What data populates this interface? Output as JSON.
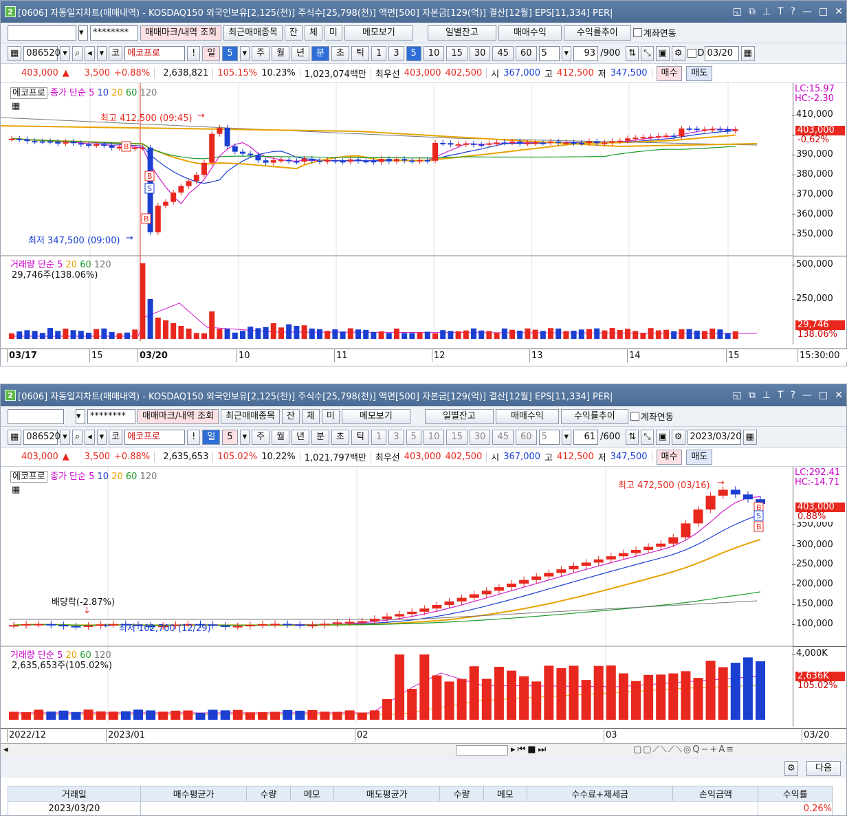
{
  "title": "[0606] 자동일지차트(매매내역) - KOSDAQ150 외국인보유[2,125(천)] 주식수[25,798(천)] 액면[500] 자본금[129(억)] 결산[12월] EPS[11,334] PER|",
  "window_num": "2",
  "toolbar": {
    "password": "********",
    "mark_btn": "매매마크/내역 조회",
    "recent_btn": "최근매매종목",
    "jan": "잔",
    "che": "체",
    "mi": "미",
    "memo_btn": "메모보기",
    "daily_btn": "일별잔고",
    "profit_btn": "매매수익",
    "rate_btn": "수익률추이",
    "account_link": "계좌연동"
  },
  "row2": {
    "code": "086520",
    "market": "코",
    "name": "에코프로",
    "excl": "!",
    "periods": [
      "일",
      "5",
      "주",
      "월",
      "년",
      "분",
      "초",
      "틱"
    ],
    "intervals": [
      "1",
      "3",
      "5",
      "10",
      "15",
      "30",
      "45",
      "60"
    ],
    "count": "5",
    "d": "D"
  },
  "w1": {
    "selected_period": "분",
    "range_value": "93",
    "range_max": "/900",
    "date": "03/20"
  },
  "w2": {
    "selected_period": "일",
    "range_value": "61",
    "range_max": "/600",
    "date": "2023/03/20"
  },
  "quote1": {
    "price": "403,000",
    "arrow": "▲",
    "change": "3,500",
    "pct": "+0.88%",
    "volume": "2,638,821",
    "vol_ratio": "105.15%",
    "turnover": "10.23%",
    "amount": "1,023,074백만",
    "best_label": "최우선",
    "ask": "403,000",
    "bid": "402,500",
    "open_label": "시",
    "open": "367,000",
    "high_label": "고",
    "high": "412,500",
    "low_label": "저",
    "low": "347,500",
    "buy": "매수",
    "sell": "매도"
  },
  "quote2": {
    "price": "403,000",
    "arrow": "▲",
    "change": "3,500",
    "pct": "+0.88%",
    "volume": "2,635,653",
    "vol_ratio": "105.02%",
    "turnover": "10.22%",
    "amount": "1,021,797백만",
    "best_label": "최우선",
    "ask": "403,000",
    "bid": "402,500",
    "open_label": "시",
    "open": "367,000",
    "high_label": "고",
    "high": "412,500",
    "low_label": "저",
    "low": "347,500",
    "buy": "매수",
    "sell": "매도"
  },
  "legend": {
    "name": "에코프로",
    "price": "종가 단순",
    "ma5": "5",
    "ma10": "10",
    "ma20": "20",
    "ma60": "60",
    "ma120": "120",
    "vol": "거래량",
    "vol_simple": "단순"
  },
  "c1": {
    "lc": "LC:15.97",
    "hc": "HC:-2.30",
    "cur": "403,000",
    "cur_pct": "-0.62%",
    "high_ann": "최고 412,500 (09:45)",
    "low_ann": "최저 347,500 (09:00)",
    "vol_label": "29,746주(138.06%)",
    "vol_tag": "29,746",
    "vol_tag_pct": "138.06%",
    "yticks": [
      "410,000",
      "400,000",
      "390,000",
      "380,000",
      "370,000",
      "360,000",
      "350,000"
    ],
    "vticks": [
      "500,000",
      "250,000"
    ],
    "dates": [
      "03/17",
      "15",
      "03/20",
      "10",
      "11",
      "12",
      "13",
      "14",
      "15"
    ],
    "time": "15:30:00"
  },
  "c2": {
    "lc": "LC:292.41",
    "hc": "HC:-14.71",
    "cur": "403,000",
    "cur_pct": "0.88%",
    "high_ann": "최고 472,500 (03/16)",
    "low_ann": "최저 102,700 (12/29)",
    "div_ann": "배당락(-2.87%)",
    "vol_label": "2,635,653주(105.02%)",
    "vol_tag": "2,636K",
    "vol_tag_pct": "105.02%",
    "yticks": [
      "350,000",
      "300,000",
      "250,000",
      "200,000",
      "150,000",
      "100,000"
    ],
    "vticks": [
      "4,000K"
    ],
    "dates": [
      "2022/12",
      "2023/01",
      "02",
      "03"
    ],
    "end": "03/20"
  },
  "bottom": {
    "next": "다음",
    "headers": [
      "거래일",
      "매수평균가",
      "수량",
      "메모",
      "매도평균가",
      "수량",
      "메모",
      "수수료+제세금",
      "손익금액",
      "수익률"
    ],
    "row": [
      "2023/03/20",
      "",
      "",
      "",
      "",
      "",
      "",
      "",
      "",
      "0.26%"
    ]
  },
  "chart_data": [
    {
      "type": "candlestick",
      "ylim": [
        340000,
        420000
      ],
      "high": 412500,
      "low": 347500,
      "current": 403000
    },
    {
      "type": "candlestick",
      "ylim": [
        80000,
        480000
      ],
      "high": 472500,
      "low": 102700,
      "current": 403000
    }
  ]
}
